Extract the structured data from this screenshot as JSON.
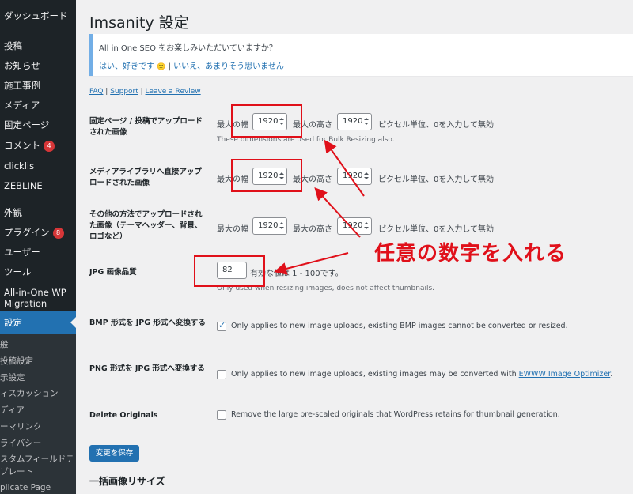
{
  "sidebar": {
    "items": [
      {
        "label": "ダッシュボード"
      },
      {
        "label": "投稿"
      },
      {
        "label": "お知らせ"
      },
      {
        "label": "施工事例"
      },
      {
        "label": "メディア"
      },
      {
        "label": "固定ページ"
      },
      {
        "label": "コメント",
        "badge": "4"
      },
      {
        "label": "clicklis"
      },
      {
        "label": "ZEBLINE"
      },
      {
        "label": "外観"
      },
      {
        "label": "プラグイン",
        "badge": "8"
      },
      {
        "label": "ユーザー"
      },
      {
        "label": "ツール"
      },
      {
        "label": "All-in-One WP",
        "label2": "Migration"
      },
      {
        "label": "設定",
        "active": true
      }
    ],
    "submenu": [
      {
        "label": "般"
      },
      {
        "label": "投稿設定"
      },
      {
        "label": "示設定"
      },
      {
        "label": "ィスカッション"
      },
      {
        "label": "ディア"
      },
      {
        "label": "ーマリンク"
      },
      {
        "label": "ライバシー"
      },
      {
        "label": "スタムフィールドテ"
      },
      {
        "label": "プレート"
      },
      {
        "label": "plicate Page"
      }
    ]
  },
  "page": {
    "title": "Imsanity 設定"
  },
  "notice": {
    "text": "All in One SEO をお楽しみいただいていますか？",
    "yes": "はい、好きです",
    "emoji": "🙂",
    "sep": " | ",
    "no": "いいえ、あまりそう思いません"
  },
  "links": {
    "faq": "FAQ",
    "support": "Support",
    "review": "Leave a Review",
    "sep": " | "
  },
  "rows": {
    "pages": {
      "label": "固定ページ / 投稿でアップロードされた画像",
      "width_label": "最大の幅",
      "width": "1920",
      "height_label": "最大の高さ",
      "height": "1920",
      "unit": "ピクセル単位、0を入力して無効",
      "hint": "These dimensions are used for Bulk Resizing also."
    },
    "media": {
      "label": "メディアライブラリへ直接アップロードされた画像",
      "width_label": "最大の幅",
      "width": "1920",
      "height_label": "最大の高さ",
      "height": "1920",
      "unit": "ピクセル単位、0を入力して無効"
    },
    "other": {
      "label": "その他の方法でアップロードされた画像（テーマヘッダー、背景、ロゴなど）",
      "width_label": "最大の幅",
      "width": "1920",
      "height_label": "最大の高さ",
      "height": "1920",
      "unit": "ピクセル単位、0を入力して無効"
    },
    "jpg": {
      "label": "JPG 画像品質",
      "value": "82",
      "text": "有効な値は 1 - 100です。",
      "hint": "Only used when resizing images, does not affect thumbnails."
    },
    "bmp": {
      "label": "BMP 形式を JPG 形式へ変換する",
      "checked": true,
      "text": "Only applies to new image uploads, existing BMP images cannot be converted or resized."
    },
    "png": {
      "label": "PNG 形式を JPG 形式へ変換する",
      "checked": false,
      "text": "Only applies to new image uploads, existing images may be converted with",
      "link": "EWWW Image Optimizer",
      "tail": "."
    },
    "delete": {
      "label": "Delete Originals",
      "checked": false,
      "text": "Remove the large pre-scaled originals that WordPress retains for thumbnail generation."
    }
  },
  "save_label": "変更を保存",
  "bulk_heading": "一括画像リサイズ",
  "annotation": {
    "text": "任意の数字を入れる",
    "color": "#e0101a"
  },
  "colors": {
    "sidebar_bg": "#1d2327",
    "accent": "#2271b1",
    "badge": "#d63638"
  }
}
